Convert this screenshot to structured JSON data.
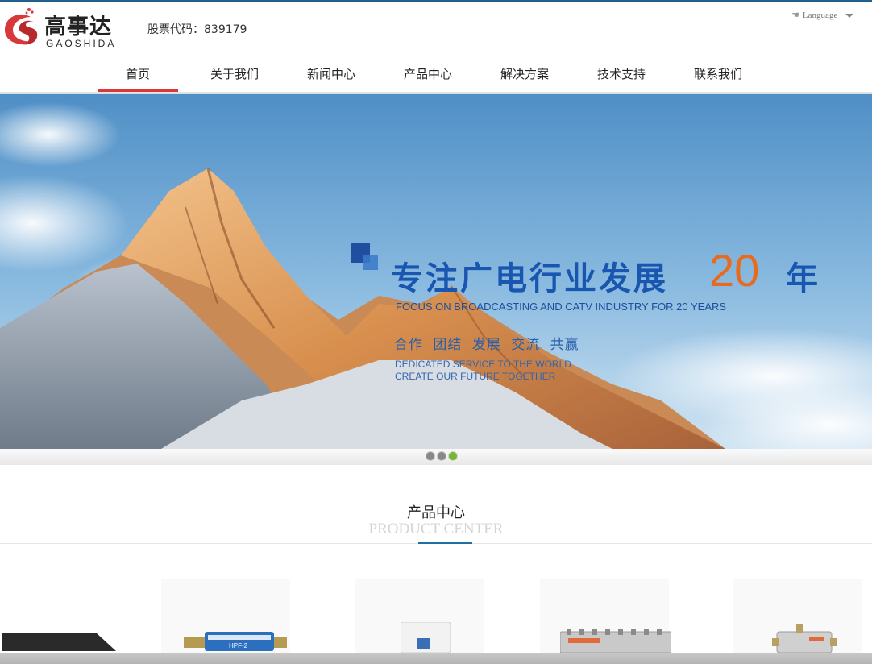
{
  "brand": {
    "logo_cn": "高事达",
    "logo_en": "GAOSHIDA",
    "stock_code": "股票代码：839179",
    "colors": {
      "logo_red": "#d9383a",
      "accent_blue": "#1956b0",
      "accent_orange": "#e86a1a"
    }
  },
  "header": {
    "language_label": "Language",
    "language_icon": "pointing-hand-icon"
  },
  "nav": {
    "items": [
      {
        "label": "首页",
        "active": true
      },
      {
        "label": "关于我们",
        "active": false
      },
      {
        "label": "新闻中心",
        "active": false
      },
      {
        "label": "产品中心",
        "active": false
      },
      {
        "label": "解决方案",
        "active": false
      },
      {
        "label": "技术支持",
        "active": false
      },
      {
        "label": "联系我们",
        "active": false
      }
    ]
  },
  "banner": {
    "title": "专注广电行业发展",
    "number": "20",
    "year": "年",
    "subtitle": "FOCUS ON BROADCASTING AND CATV INDUSTRY FOR 20 YEARS",
    "slogan": "合作 团结 发展 交流 共赢",
    "tagline1": "DEDICATED SERVICE TO THE WORLD",
    "tagline2": "CREATE OUR FUTURE TOGETHER",
    "slides": 3,
    "active_slide": 3
  },
  "products": {
    "title": "产品中心",
    "subtitle": "PRODUCT CENTER",
    "items": [
      {
        "label": "HPF-2"
      }
    ]
  }
}
